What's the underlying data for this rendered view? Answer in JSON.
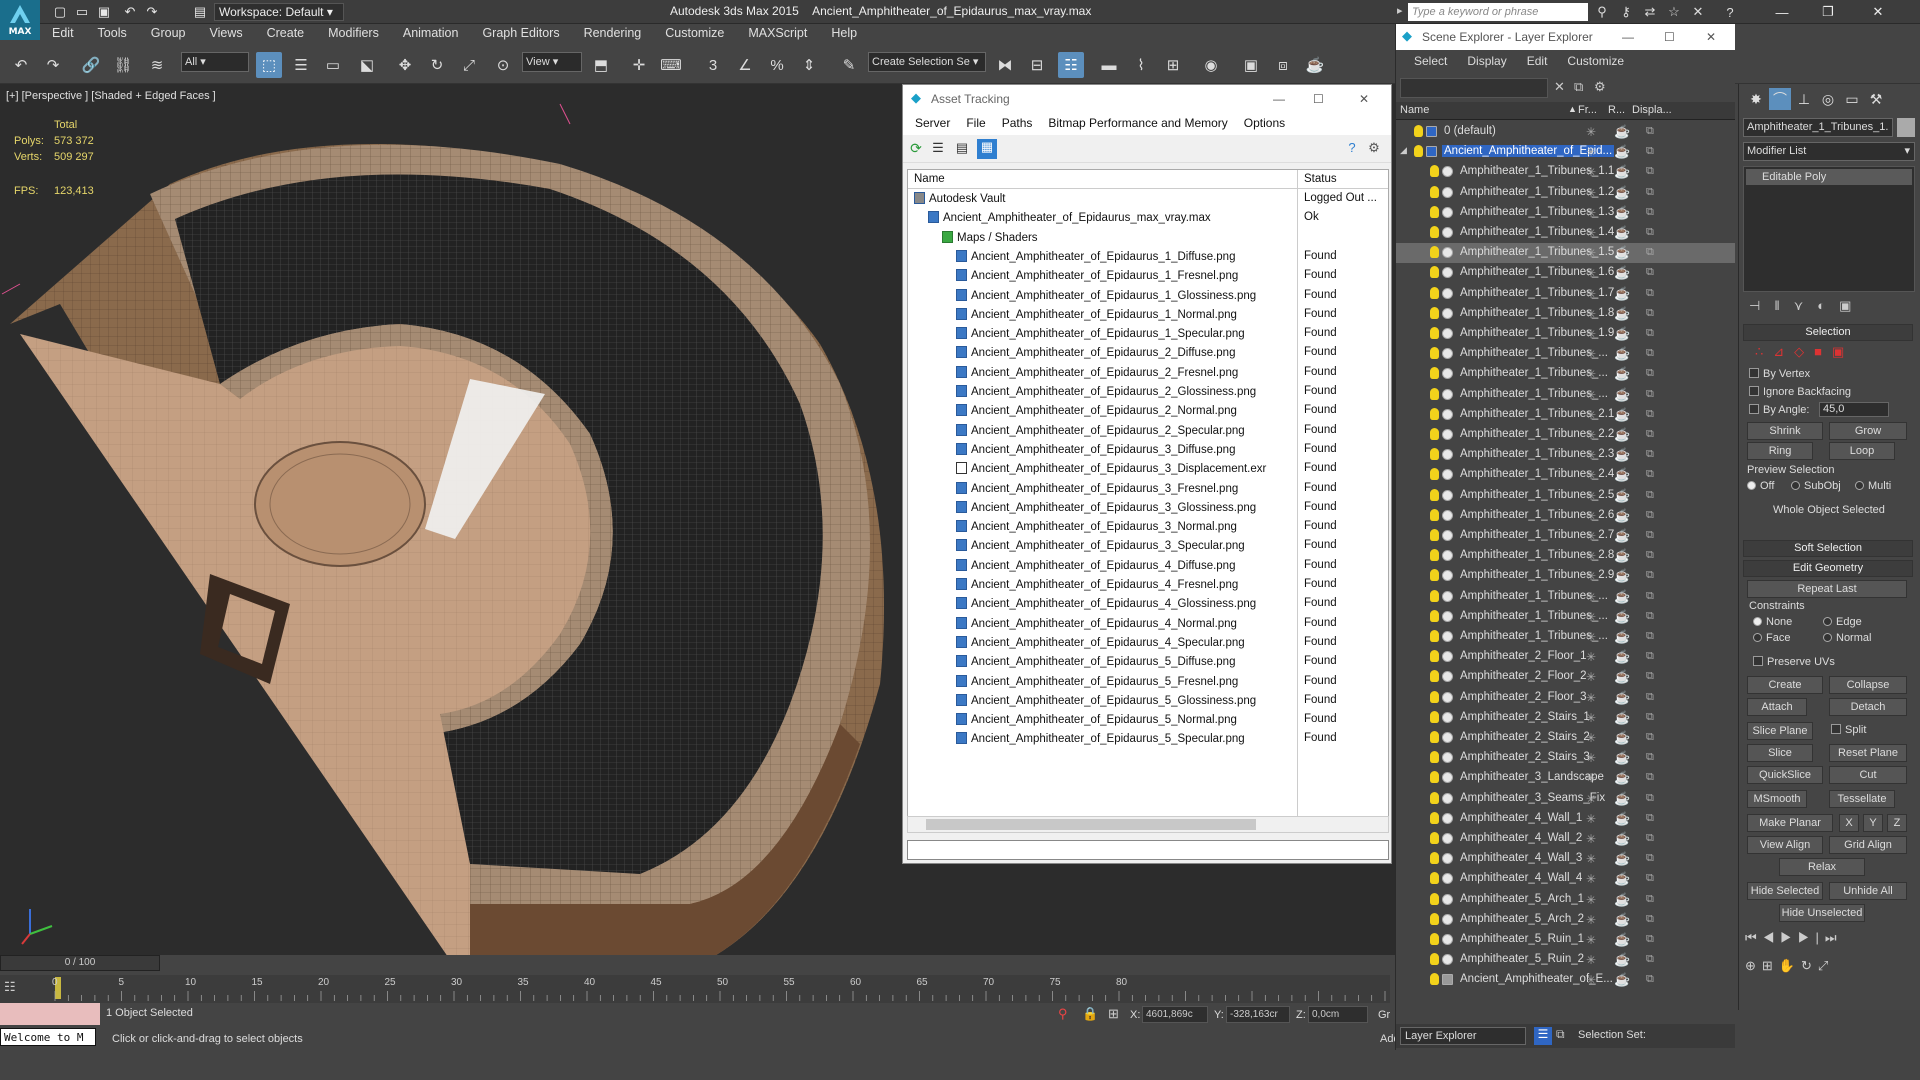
{
  "app": {
    "title": "Autodesk 3ds Max  2015",
    "file": "Ancient_Amphitheater_of_Epidaurus_max_vray.max",
    "workspace": "Workspace: Default",
    "search_placeholder": "Type a keyword or phrase",
    "logo": "MAX"
  },
  "menu": [
    "Edit",
    "Tools",
    "Group",
    "Views",
    "Create",
    "Modifiers",
    "Animation",
    "Graph Editors",
    "Rendering",
    "Customize",
    "MAXScript",
    "Help"
  ],
  "toolbar": {
    "filter": "All",
    "ref_coord": "View",
    "selection_set": "Create Selection Se"
  },
  "viewport": {
    "label": "[+] [Perspective ] [Shaded + Edged Faces ]",
    "stats_total": "Total",
    "polys_label": "Polys:",
    "polys": "573 372",
    "verts_label": "Verts:",
    "verts": "509 297",
    "fps_label": "FPS:",
    "fps": "123,413"
  },
  "timeline": {
    "frame": "0 / 100",
    "ticks": [
      "0",
      "5",
      "10",
      "15",
      "20",
      "25",
      "30",
      "35",
      "40",
      "45",
      "50",
      "55",
      "60",
      "65",
      "70",
      "75",
      "80"
    ]
  },
  "status": {
    "selected": "1 Object Selected",
    "prompt": "Click or click-and-drag to select objects",
    "mini_listener": "Welcome to M",
    "x_label": "X:",
    "x": "4601,869c",
    "y_label": "Y:",
    "y": "-328,163cr",
    "z_label": "Z:",
    "z": "0,0cm",
    "add_time_tag": "Add Time Tag",
    "grid": "Gr"
  },
  "asset_tracking": {
    "title": "Asset Tracking",
    "menu": [
      "Server",
      "File",
      "Paths",
      "Bitmap Performance and Memory",
      "Options"
    ],
    "col_name": "Name",
    "col_status": "Status",
    "rows": [
      {
        "name": "Autodesk Vault",
        "status": "Logged Out ...",
        "indent": 0,
        "kind": "vault"
      },
      {
        "name": "Ancient_Amphitheater_of_Epidaurus_max_vray.max",
        "status": "Ok",
        "indent": 1,
        "kind": "max"
      },
      {
        "name": "Maps / Shaders",
        "status": "",
        "indent": 2,
        "kind": "maps"
      },
      {
        "name": "Ancient_Amphitheater_of_Epidaurus_1_Diffuse.png",
        "status": "Found",
        "indent": 3,
        "kind": "file"
      },
      {
        "name": "Ancient_Amphitheater_of_Epidaurus_1_Fresnel.png",
        "status": "Found",
        "indent": 3,
        "kind": "file"
      },
      {
        "name": "Ancient_Amphitheater_of_Epidaurus_1_Glossiness.png",
        "status": "Found",
        "indent": 3,
        "kind": "file"
      },
      {
        "name": "Ancient_Amphitheater_of_Epidaurus_1_Normal.png",
        "status": "Found",
        "indent": 3,
        "kind": "file"
      },
      {
        "name": "Ancient_Amphitheater_of_Epidaurus_1_Specular.png",
        "status": "Found",
        "indent": 3,
        "kind": "file"
      },
      {
        "name": "Ancient_Amphitheater_of_Epidaurus_2_Diffuse.png",
        "status": "Found",
        "indent": 3,
        "kind": "file"
      },
      {
        "name": "Ancient_Amphitheater_of_Epidaurus_2_Fresnel.png",
        "status": "Found",
        "indent": 3,
        "kind": "file"
      },
      {
        "name": "Ancient_Amphitheater_of_Epidaurus_2_Glossiness.png",
        "status": "Found",
        "indent": 3,
        "kind": "file"
      },
      {
        "name": "Ancient_Amphitheater_of_Epidaurus_2_Normal.png",
        "status": "Found",
        "indent": 3,
        "kind": "file"
      },
      {
        "name": "Ancient_Amphitheater_of_Epidaurus_2_Specular.png",
        "status": "Found",
        "indent": 3,
        "kind": "file"
      },
      {
        "name": "Ancient_Amphitheater_of_Epidaurus_3_Diffuse.png",
        "status": "Found",
        "indent": 3,
        "kind": "file"
      },
      {
        "name": "Ancient_Amphitheater_of_Epidaurus_3_Displacement.exr",
        "status": "Found",
        "indent": 3,
        "kind": "exr"
      },
      {
        "name": "Ancient_Amphitheater_of_Epidaurus_3_Fresnel.png",
        "status": "Found",
        "indent": 3,
        "kind": "file"
      },
      {
        "name": "Ancient_Amphitheater_of_Epidaurus_3_Glossiness.png",
        "status": "Found",
        "indent": 3,
        "kind": "file"
      },
      {
        "name": "Ancient_Amphitheater_of_Epidaurus_3_Normal.png",
        "status": "Found",
        "indent": 3,
        "kind": "file"
      },
      {
        "name": "Ancient_Amphitheater_of_Epidaurus_3_Specular.png",
        "status": "Found",
        "indent": 3,
        "kind": "file"
      },
      {
        "name": "Ancient_Amphitheater_of_Epidaurus_4_Diffuse.png",
        "status": "Found",
        "indent": 3,
        "kind": "file"
      },
      {
        "name": "Ancient_Amphitheater_of_Epidaurus_4_Fresnel.png",
        "status": "Found",
        "indent": 3,
        "kind": "file"
      },
      {
        "name": "Ancient_Amphitheater_of_Epidaurus_4_Glossiness.png",
        "status": "Found",
        "indent": 3,
        "kind": "file"
      },
      {
        "name": "Ancient_Amphitheater_of_Epidaurus_4_Normal.png",
        "status": "Found",
        "indent": 3,
        "kind": "file"
      },
      {
        "name": "Ancient_Amphitheater_of_Epidaurus_4_Specular.png",
        "status": "Found",
        "indent": 3,
        "kind": "file"
      },
      {
        "name": "Ancient_Amphitheater_of_Epidaurus_5_Diffuse.png",
        "status": "Found",
        "indent": 3,
        "kind": "file"
      },
      {
        "name": "Ancient_Amphitheater_of_Epidaurus_5_Fresnel.png",
        "status": "Found",
        "indent": 3,
        "kind": "file"
      },
      {
        "name": "Ancient_Amphitheater_of_Epidaurus_5_Glossiness.png",
        "status": "Found",
        "indent": 3,
        "kind": "file"
      },
      {
        "name": "Ancient_Amphitheater_of_Epidaurus_5_Normal.png",
        "status": "Found",
        "indent": 3,
        "kind": "file"
      },
      {
        "name": "Ancient_Amphitheater_of_Epidaurus_5_Specular.png",
        "status": "Found",
        "indent": 3,
        "kind": "file"
      }
    ]
  },
  "scene_explorer": {
    "title": "Scene Explorer - Layer Explorer",
    "menu": [
      "Select",
      "Display",
      "Edit",
      "Customize"
    ],
    "col_name": "Name",
    "col_freeze": "Fr...",
    "col_render": "R...",
    "col_display": "Displa...",
    "footer_dropdown": "Layer Explorer",
    "footer_selection_set": "Selection Set:",
    "rows": [
      {
        "name": "0 (default)",
        "type": "layer",
        "state": ""
      },
      {
        "name": "Ancient_Amphitheater_of_Epid...",
        "type": "layer",
        "state": "active"
      },
      {
        "name": "Amphitheater_1_Tribunes_1.1",
        "type": "obj",
        "state": ""
      },
      {
        "name": "Amphitheater_1_Tribunes_1.2",
        "type": "obj",
        "state": ""
      },
      {
        "name": "Amphitheater_1_Tribunes_1.3",
        "type": "obj",
        "state": ""
      },
      {
        "name": "Amphitheater_1_Tribunes_1.4",
        "type": "obj",
        "state": ""
      },
      {
        "name": "Amphitheater_1_Tribunes_1.5",
        "type": "obj",
        "state": "selected"
      },
      {
        "name": "Amphitheater_1_Tribunes_1.6",
        "type": "obj",
        "state": ""
      },
      {
        "name": "Amphitheater_1_Tribunes_1.7",
        "type": "obj",
        "state": ""
      },
      {
        "name": "Amphitheater_1_Tribunes_1.8",
        "type": "obj",
        "state": ""
      },
      {
        "name": "Amphitheater_1_Tribunes_1.9",
        "type": "obj",
        "state": ""
      },
      {
        "name": "Amphitheater_1_Tribunes_...",
        "type": "obj",
        "state": ""
      },
      {
        "name": "Amphitheater_1_Tribunes_...",
        "type": "obj",
        "state": ""
      },
      {
        "name": "Amphitheater_1_Tribunes_...",
        "type": "obj",
        "state": ""
      },
      {
        "name": "Amphitheater_1_Tribunes_2.1",
        "type": "obj",
        "state": ""
      },
      {
        "name": "Amphitheater_1_Tribunes_2.2",
        "type": "obj",
        "state": ""
      },
      {
        "name": "Amphitheater_1_Tribunes_2.3",
        "type": "obj",
        "state": ""
      },
      {
        "name": "Amphitheater_1_Tribunes_2.4",
        "type": "obj",
        "state": ""
      },
      {
        "name": "Amphitheater_1_Tribunes_2.5",
        "type": "obj",
        "state": ""
      },
      {
        "name": "Amphitheater_1_Tribunes_2.6",
        "type": "obj",
        "state": ""
      },
      {
        "name": "Amphitheater_1_Tribunes_2.7",
        "type": "obj",
        "state": ""
      },
      {
        "name": "Amphitheater_1_Tribunes_2.8",
        "type": "obj",
        "state": ""
      },
      {
        "name": "Amphitheater_1_Tribunes_2.9",
        "type": "obj",
        "state": ""
      },
      {
        "name": "Amphitheater_1_Tribunes_...",
        "type": "obj",
        "state": ""
      },
      {
        "name": "Amphitheater_1_Tribunes_...",
        "type": "obj",
        "state": ""
      },
      {
        "name": "Amphitheater_1_Tribunes_...",
        "type": "obj",
        "state": ""
      },
      {
        "name": "Amphitheater_2_Floor_1",
        "type": "obj",
        "state": ""
      },
      {
        "name": "Amphitheater_2_Floor_2",
        "type": "obj",
        "state": ""
      },
      {
        "name": "Amphitheater_2_Floor_3",
        "type": "obj",
        "state": ""
      },
      {
        "name": "Amphitheater_2_Stairs_1",
        "type": "obj",
        "state": ""
      },
      {
        "name": "Amphitheater_2_Stairs_2",
        "type": "obj",
        "state": ""
      },
      {
        "name": "Amphitheater_2_Stairs_3",
        "type": "obj",
        "state": ""
      },
      {
        "name": "Amphitheater_3_Landscape",
        "type": "obj",
        "state": ""
      },
      {
        "name": "Amphitheater_3_Seams_Fix",
        "type": "obj",
        "state": ""
      },
      {
        "name": "Amphitheater_4_Wall_1",
        "type": "obj",
        "state": ""
      },
      {
        "name": "Amphitheater_4_Wall_2",
        "type": "obj",
        "state": ""
      },
      {
        "name": "Amphitheater_4_Wall_3",
        "type": "obj",
        "state": ""
      },
      {
        "name": "Amphitheater_4_Wall_4",
        "type": "obj",
        "state": ""
      },
      {
        "name": "Amphitheater_5_Arch_1",
        "type": "obj",
        "state": ""
      },
      {
        "name": "Amphitheater_5_Arch_2",
        "type": "obj",
        "state": ""
      },
      {
        "name": "Amphitheater_5_Ruin_1",
        "type": "obj",
        "state": ""
      },
      {
        "name": "Amphitheater_5_Ruin_2",
        "type": "obj",
        "state": ""
      },
      {
        "name": "Ancient_Amphitheater_of_E...",
        "type": "group",
        "state": ""
      }
    ]
  },
  "command_panel": {
    "object_name": "Amphitheater_1_Tribunes_1.",
    "modifier_list": "Modifier List",
    "stack_item": "Editable Poly",
    "selection_header": "Selection",
    "by_vertex": "By Vertex",
    "ignore_backfacing": "Ignore Backfacing",
    "by_angle": "By Angle:",
    "angle_value": "45,0",
    "shrink": "Shrink",
    "grow": "Grow",
    "ring": "Ring",
    "loop": "Loop",
    "preview_selection": "Preview Selection",
    "off": "Off",
    "subobj": "SubObj",
    "multi": "Multi",
    "whole_object": "Whole Object Selected",
    "soft_selection": "Soft Selection",
    "edit_geometry": "Edit Geometry",
    "repeat_last": "Repeat Last",
    "constraints": "Constraints",
    "none": "None",
    "edge": "Edge",
    "face": "Face",
    "normal": "Normal",
    "preserve_uvs": "Preserve UVs",
    "create": "Create",
    "collapse": "Collapse",
    "attach": "Attach",
    "detach": "Detach",
    "slice_plane": "Slice Plane",
    "split": "Split",
    "slice": "Slice",
    "reset_plane": "Reset Plane",
    "quickslice": "QuickSlice",
    "cut": "Cut",
    "msmooth": "MSmooth",
    "tessellate": "Tessellate",
    "make_planar": "Make Planar",
    "x": "X",
    "y": "Y",
    "z": "Z",
    "view_align": "View Align",
    "grid_align": "Grid Align",
    "relax": "Relax",
    "hide_selected": "Hide Selected",
    "unhide_all": "Unhide All",
    "hide_unselected": "Hide Unselected"
  },
  "colors": {
    "accent": "#2f66c3",
    "selection": "#5c8fbd",
    "yellow": "#e6d66a"
  }
}
